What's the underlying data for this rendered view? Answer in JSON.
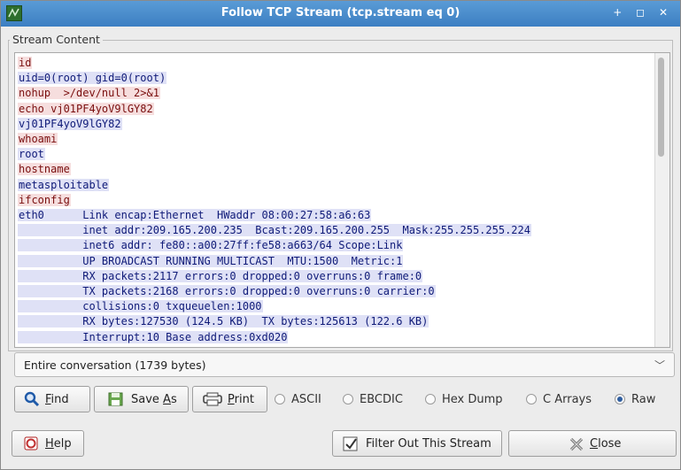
{
  "window": {
    "title": "Follow TCP Stream (tcp.stream eq 0)",
    "controls": "+ ◻ ✕"
  },
  "group_label": "Stream Content",
  "stream_lines": [
    {
      "dir": "c",
      "text": "id"
    },
    {
      "dir": "s",
      "text": "uid=0(root) gid=0(root)"
    },
    {
      "dir": "c",
      "text": "nohup  >/dev/null 2>&1"
    },
    {
      "dir": "c",
      "text": "echo vj01PF4yoV9lGY82"
    },
    {
      "dir": "s",
      "text": "vj01PF4yoV9lGY82"
    },
    {
      "dir": "c",
      "text": "whoami"
    },
    {
      "dir": "s",
      "text": "root"
    },
    {
      "dir": "c",
      "text": "hostname"
    },
    {
      "dir": "s",
      "text": "metasploitable"
    },
    {
      "dir": "c",
      "text": "ifconfig"
    },
    {
      "dir": "s",
      "text": "eth0      Link encap:Ethernet  HWaddr 08:00:27:58:a6:63"
    },
    {
      "dir": "s",
      "text": "          inet addr:209.165.200.235  Bcast:209.165.200.255  Mask:255.255.255.224"
    },
    {
      "dir": "s",
      "text": "          inet6 addr: fe80::a00:27ff:fe58:a663/64 Scope:Link"
    },
    {
      "dir": "s",
      "text": "          UP BROADCAST RUNNING MULTICAST  MTU:1500  Metric:1"
    },
    {
      "dir": "s",
      "text": "          RX packets:2117 errors:0 dropped:0 overruns:0 frame:0"
    },
    {
      "dir": "s",
      "text": "          TX packets:2168 errors:0 dropped:0 overruns:0 carrier:0"
    },
    {
      "dir": "s",
      "text": "          collisions:0 txqueuelen:1000"
    },
    {
      "dir": "s",
      "text": "          RX bytes:127530 (124.5 KB)  TX bytes:125613 (122.6 KB)"
    },
    {
      "dir": "s",
      "text": "          Interrupt:10 Base address:0xd020"
    }
  ],
  "conversation_select": {
    "value": "Entire conversation (1739 bytes)"
  },
  "toolbar": {
    "find": {
      "pre": "",
      "u": "F",
      "post": "ind"
    },
    "save_as": {
      "pre": "Save ",
      "u": "A",
      "post": "s"
    },
    "print": {
      "pre": "",
      "u": "P",
      "post": "rint"
    }
  },
  "formats": [
    {
      "label": "ASCII",
      "selected": false
    },
    {
      "label": "EBCDIC",
      "selected": false
    },
    {
      "label": "Hex Dump",
      "selected": false
    },
    {
      "label": "C Arrays",
      "selected": false
    },
    {
      "label": "Raw",
      "selected": true
    }
  ],
  "bottom": {
    "help": {
      "pre": "",
      "u": "H",
      "post": "elp"
    },
    "filter_out": "Filter Out This Stream",
    "close": {
      "pre": "",
      "u": "C",
      "post": "lose"
    }
  },
  "colors": {
    "client_text": "#7a0f0f",
    "client_bg": "#f6dede",
    "server_text": "#0f1a78",
    "server_bg": "#dfe1f6",
    "titlebar": "#4a8ccc"
  }
}
